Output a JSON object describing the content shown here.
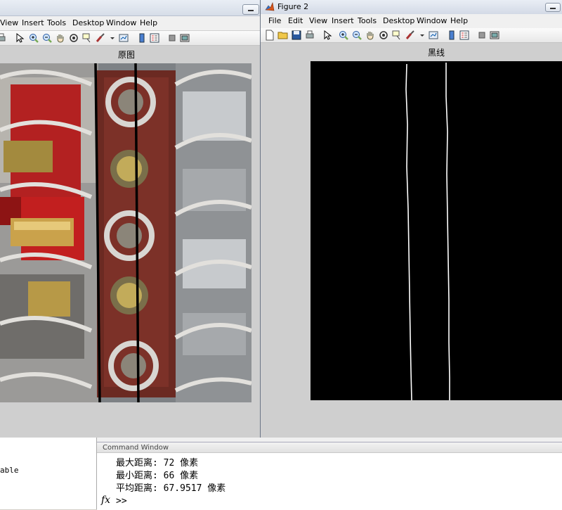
{
  "figure1": {
    "menu": [
      "View",
      "Insert",
      "Tools",
      "Desktop",
      "Window",
      "Help"
    ],
    "axes_title": "原图"
  },
  "figure2": {
    "window_title": "Figure 2",
    "menu": [
      "File",
      "Edit",
      "View",
      "Insert",
      "Tools",
      "Desktop",
      "Window",
      "Help"
    ],
    "axes_title": "黑线"
  },
  "left_panel": {
    "partial_text": "able"
  },
  "command_window": {
    "title": "Command Window",
    "lines": [
      "最大距离: 72 像素",
      "最小距离: 66 像素",
      "平均距离: 67.9517 像素"
    ],
    "fx_symbol": "fx",
    "prompt": ">>"
  },
  "toolbar_icons": [
    "new-file-icon",
    "open-folder-icon",
    "save-icon",
    "print-icon",
    "pointer-icon",
    "zoom-in-icon",
    "zoom-out-icon",
    "pan-hand-icon",
    "rotate-3d-icon",
    "data-cursor-icon",
    "brush-icon",
    "link-plot-icon",
    "colorbar-icon",
    "legend-icon",
    "hide-plot-tools-icon",
    "show-plot-tools-icon"
  ],
  "colors": {
    "background": "#d4d0c8",
    "figure_background": "#cfcfcf",
    "image_background": "#000000",
    "line_color": "#ffffff"
  }
}
